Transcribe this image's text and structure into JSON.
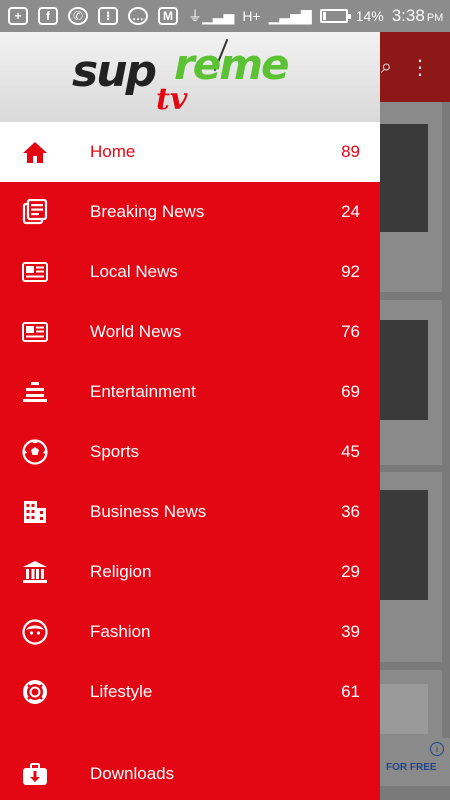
{
  "status_bar": {
    "battery": "14%",
    "time": "3:38",
    "ampm": "PM",
    "network": "H+",
    "battery_level": 0.14
  },
  "drawer": {
    "logo": {
      "word1": "sup",
      "word2": "reme",
      "word3": "tv"
    },
    "items": [
      {
        "label": "Home",
        "count": "89",
        "icon": "home-icon",
        "active": true
      },
      {
        "label": "Breaking News",
        "count": "24",
        "icon": "newspaper-icon"
      },
      {
        "label": "Local News",
        "count": "92",
        "icon": "news-article-icon"
      },
      {
        "label": "World News",
        "count": "76",
        "icon": "news-article-icon"
      },
      {
        "label": "Entertainment",
        "count": "69",
        "icon": "stage-icon"
      },
      {
        "label": "Sports",
        "count": "45",
        "icon": "soccer-ball-icon"
      },
      {
        "label": "Business News",
        "count": "36",
        "icon": "building-icon"
      },
      {
        "label": "Religion",
        "count": "29",
        "icon": "temple-icon"
      },
      {
        "label": "Fashion",
        "count": "39",
        "icon": "face-icon"
      },
      {
        "label": "Lifestyle",
        "count": "61",
        "icon": "life-ring-icon"
      }
    ],
    "downloads": {
      "label": "Downloads",
      "icon": "download-box-icon"
    }
  },
  "background": {
    "ad_text": "FOR FREE"
  },
  "colors": {
    "accent": "#e30613",
    "logo_green": "#5cc233"
  }
}
